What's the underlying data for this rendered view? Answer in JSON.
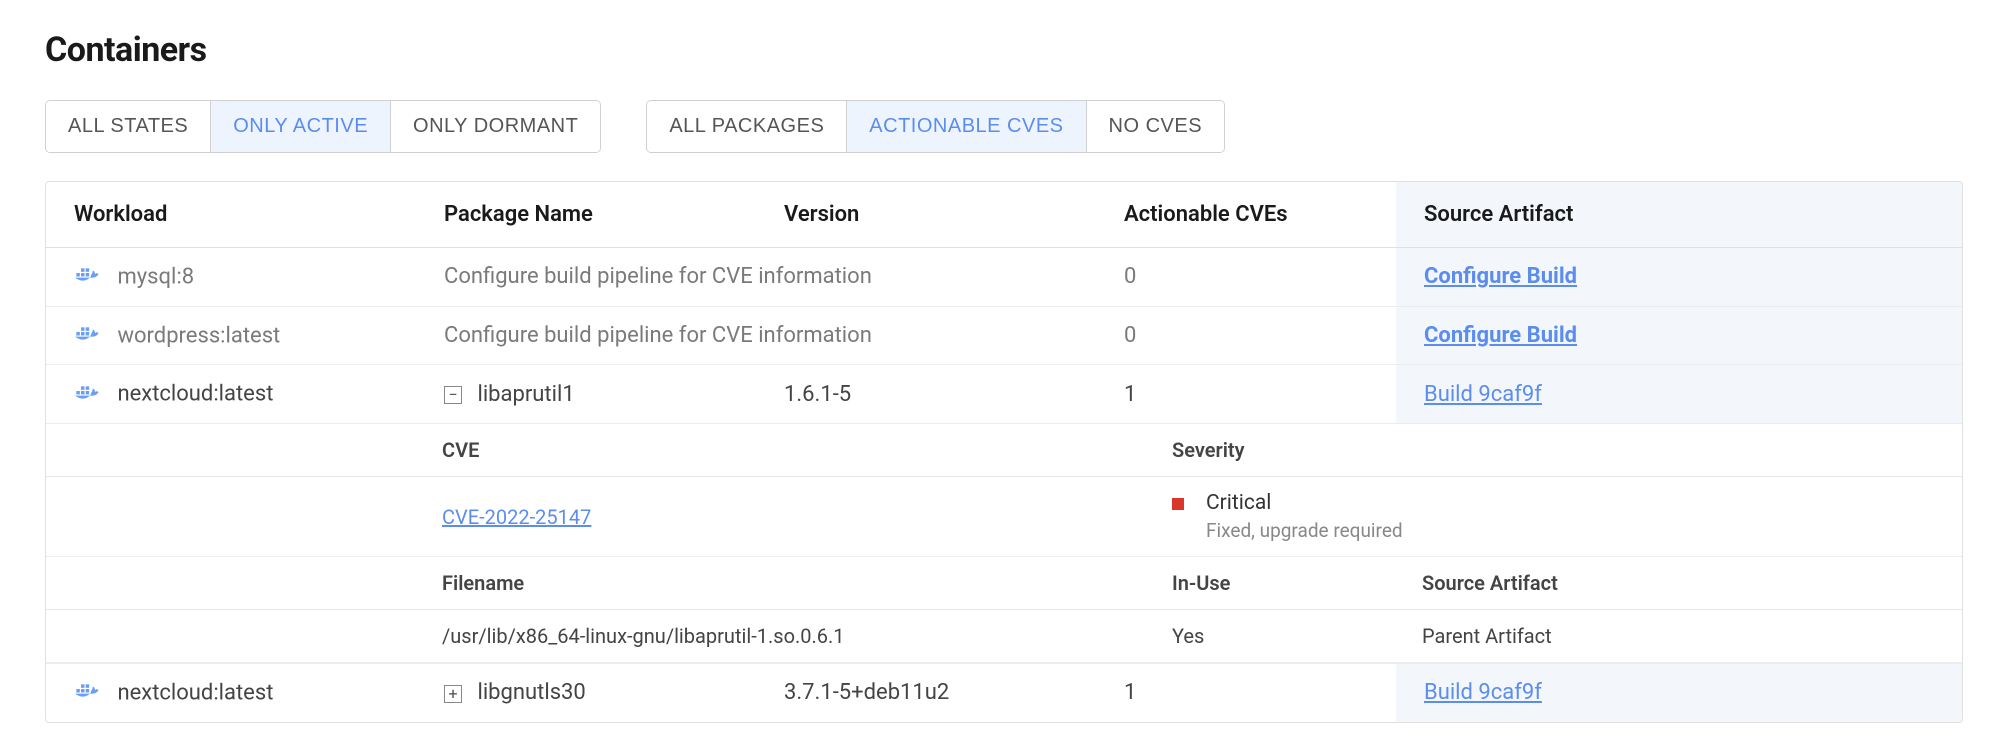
{
  "title": "Containers",
  "filters": {
    "states": [
      {
        "label": "ALL STATES",
        "active": false
      },
      {
        "label": "ONLY ACTIVE",
        "active": true
      },
      {
        "label": "ONLY DORMANT",
        "active": false
      }
    ],
    "packages": [
      {
        "label": "ALL PACKAGES",
        "active": false
      },
      {
        "label": "ACTIONABLE CVES",
        "active": true
      },
      {
        "label": "NO CVES",
        "active": false
      }
    ]
  },
  "columns": {
    "workload": "Workload",
    "package": "Package Name",
    "version": "Version",
    "cves": "Actionable CVEs",
    "source": "Source Artifact"
  },
  "rows": [
    {
      "workload": "mysql:8",
      "package": "Configure build pipeline for CVE information",
      "version": "",
      "cves": "0",
      "source": "Configure Build",
      "muted": true,
      "source_bold": true
    },
    {
      "workload": "wordpress:latest",
      "package": "Configure build pipeline for CVE information",
      "version": "",
      "cves": "0",
      "source": "Configure Build",
      "muted": true,
      "source_bold": true
    },
    {
      "workload": "nextcloud:latest",
      "package": "libaprutil1",
      "version": "1.6.1-5",
      "cves": "1",
      "source": "Build 9caf9f",
      "expand": "minus",
      "muted": false,
      "source_bold": false
    },
    {
      "workload": "nextcloud:latest",
      "package": "libgnutls30",
      "version": "3.7.1-5+deb11u2",
      "cves": "1",
      "source": "Build 9caf9f",
      "expand": "plus",
      "muted": false,
      "source_bold": false
    }
  ],
  "cve_detail": {
    "headers": {
      "cve": "CVE",
      "severity": "Severity"
    },
    "cve_id": "CVE-2022-25147",
    "severity": "Critical",
    "severity_note": "Fixed, upgrade required",
    "file_headers": {
      "filename": "Filename",
      "inuse": "In-Use",
      "source": "Source Artifact"
    },
    "filename": "/usr/lib/x86_64-linux-gnu/libaprutil-1.so.0.6.1",
    "inuse": "Yes",
    "source": "Parent Artifact"
  }
}
